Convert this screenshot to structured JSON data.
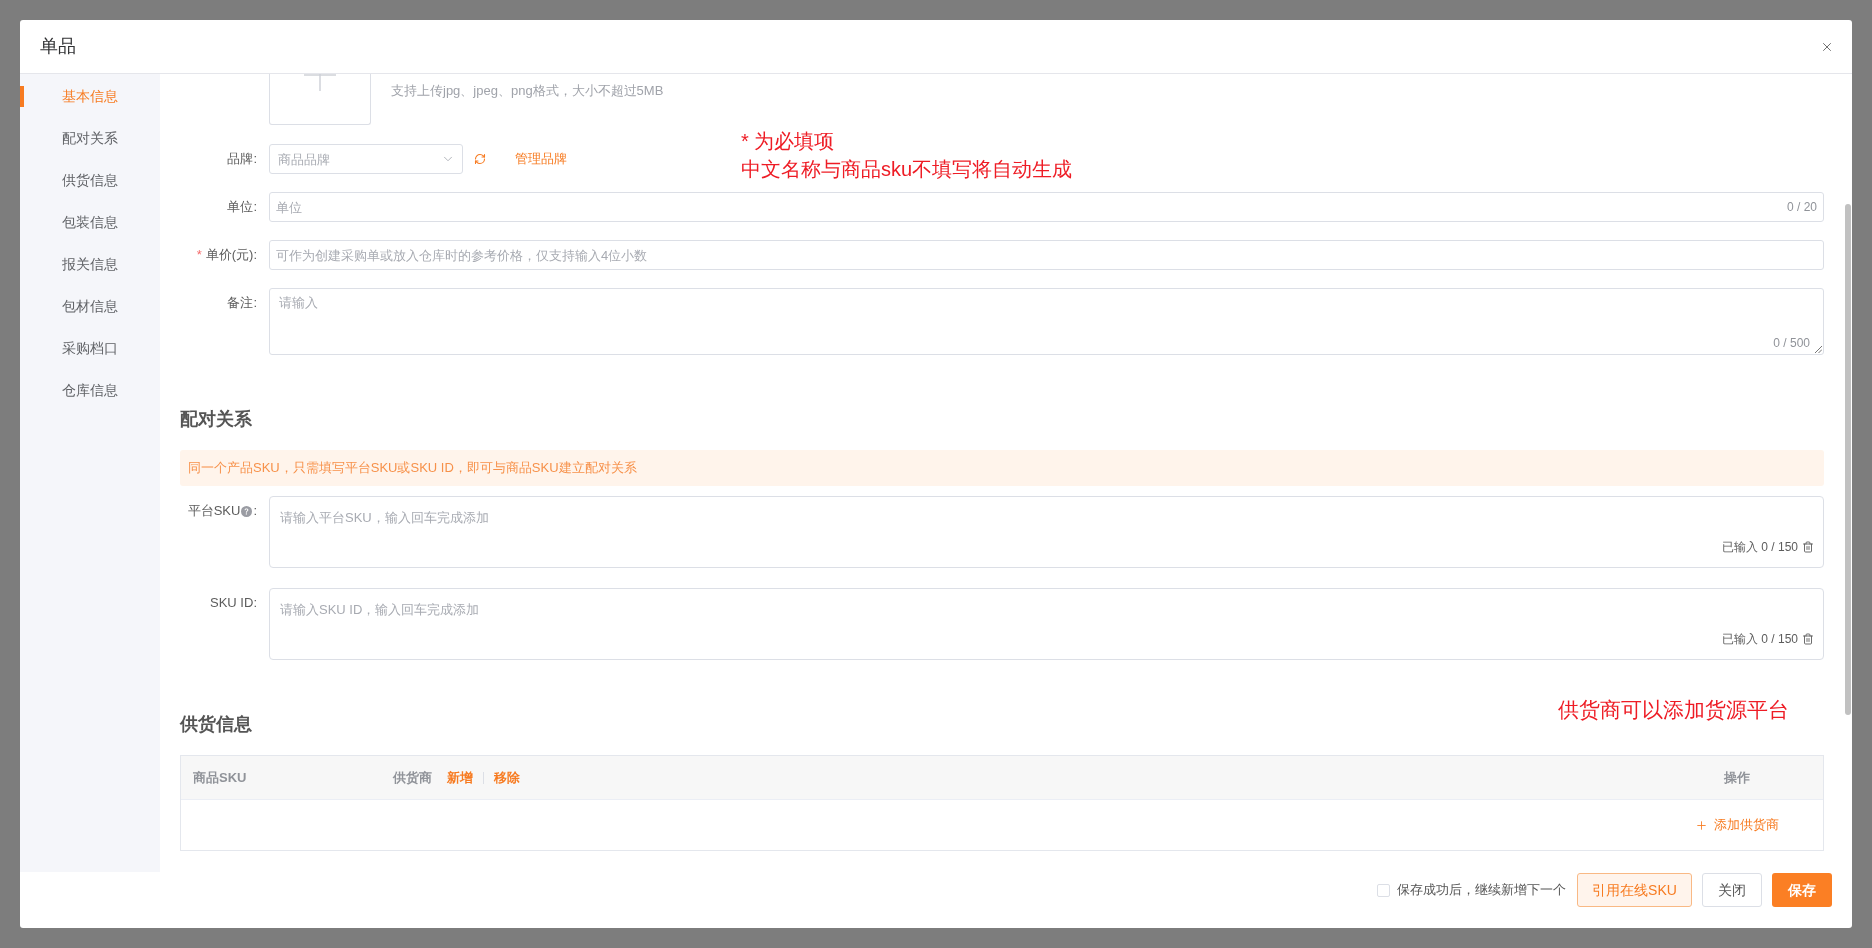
{
  "dialog": {
    "title": "单品"
  },
  "sidebar": {
    "items": [
      {
        "label": "基本信息",
        "selected": true
      },
      {
        "label": "配对关系",
        "selected": false
      },
      {
        "label": "供货信息",
        "selected": false
      },
      {
        "label": "包装信息",
        "selected": false
      },
      {
        "label": "报关信息",
        "selected": false
      },
      {
        "label": "包材信息",
        "selected": false
      },
      {
        "label": "采购档口",
        "selected": false
      },
      {
        "label": "仓库信息",
        "selected": false
      }
    ]
  },
  "basic_info": {
    "upload_hint": "支持上传jpg、jpeg、png格式，大小不超过5MB",
    "note": [
      "* 为必填项",
      "中文名称与商品sku不填写将自动生成"
    ],
    "fields": [
      {
        "kind": "select",
        "label": "品牌:",
        "placeholder": "商品品牌",
        "link": "管理品牌"
      },
      {
        "kind": "input",
        "label": "单位:",
        "placeholder": "单位",
        "counter": "0 / 20"
      },
      {
        "kind": "input",
        "label": "单价(元):",
        "required_mark": "*",
        "placeholder": "可作为创建采购单或放入仓库时的参考价格，仅支持输入4位小数"
      },
      {
        "kind": "textarea",
        "label": "备注:",
        "placeholder": "请输入",
        "counter": "0 / 500"
      }
    ]
  },
  "pairing": {
    "heading": "配对关系",
    "alert": "同一个产品SKU，只需填写平台SKU或SKU ID，即可与商品SKU建立配对关系",
    "fields": [
      {
        "label": "平台SKU",
        "help": true,
        "colon": ":",
        "placeholder": "请输入平台SKU，输入回车完成添加",
        "counter": "已输入 0 / 150"
      },
      {
        "label": "SKU ID",
        "help": false,
        "colon": ":",
        "placeholder": "请输入SKU ID，输入回车完成添加",
        "counter": "已输入 0 / 150"
      }
    ]
  },
  "supply": {
    "heading": "供货信息",
    "note": "供货商可以添加货源平台",
    "table": {
      "columns": [
        {
          "label": "商品SKU"
        },
        {
          "label": "供货商",
          "actions": [
            "新增",
            "移除"
          ]
        },
        {
          "label": "操作"
        }
      ],
      "add_link": "添加供货商"
    }
  },
  "footer": {
    "checkbox": {
      "label": "保存成功后，继续新增下一个",
      "checked": false
    },
    "buttons": [
      {
        "kind": "secondary",
        "label": "引用在线SKU"
      },
      {
        "kind": "default",
        "label": "关闭"
      },
      {
        "kind": "primary",
        "label": "保存"
      }
    ]
  }
}
